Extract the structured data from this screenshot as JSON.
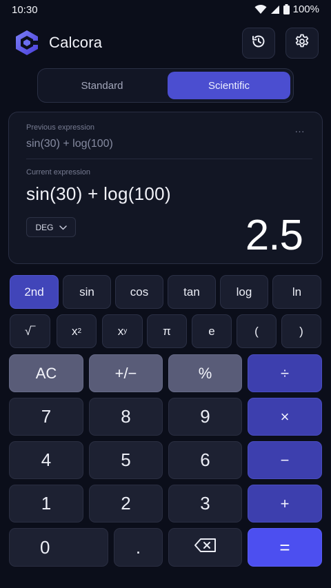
{
  "status_bar": {
    "time": "10:30",
    "battery": "100%"
  },
  "header": {
    "app_title": "Calcora"
  },
  "mode": {
    "tabs": [
      "Standard",
      "Scientific"
    ],
    "selected": "Scientific"
  },
  "display": {
    "previous_label": "Previous expression",
    "previous_expression": "sin(30) + log(100)",
    "more": "…",
    "current_label": "Current expression",
    "current_expression": "sin(30) + log(100)",
    "angle_mode": "DEG",
    "result": "2.5"
  },
  "scientific_keys": {
    "row1": [
      "2nd",
      "sin",
      "cos",
      "tan",
      "log",
      "ln"
    ],
    "row2": {
      "sqrt": "√‾",
      "square_base": "x",
      "square_exp": "2",
      "power_base": "x",
      "power_exp": "y",
      "pi": "π",
      "e": "e",
      "open_paren": "(",
      "close_paren": ")"
    }
  },
  "keys": {
    "ac": "AC",
    "plus_minus": "+/−",
    "percent": "%",
    "divide": "÷",
    "seven": "7",
    "eight": "8",
    "nine": "9",
    "multiply": "×",
    "four": "4",
    "five": "5",
    "six": "6",
    "minus": "−",
    "one": "1",
    "two": "2",
    "three": "3",
    "plus": "+",
    "zero": "0",
    "decimal": ".",
    "equals": "="
  },
  "colors": {
    "background": "#0b0e1a",
    "accent": "#4b4ed0",
    "operator": "#3d3fae",
    "equals": "#4c4ff0",
    "function": "#595c78"
  }
}
